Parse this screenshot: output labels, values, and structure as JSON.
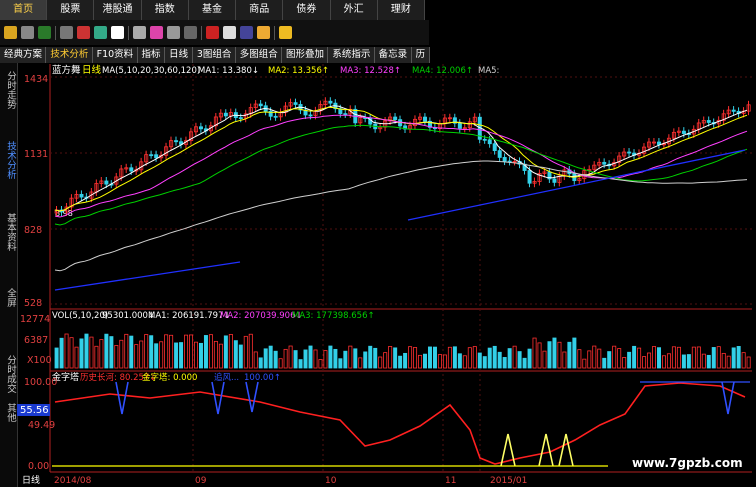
{
  "menu": [
    {
      "label": "首页",
      "active": true
    },
    {
      "label": "股票",
      "active": false
    },
    {
      "label": "港股通",
      "active": false
    },
    {
      "label": "指数",
      "active": false
    },
    {
      "label": "基金",
      "active": false
    },
    {
      "label": "商品",
      "active": false
    },
    {
      "label": "债券",
      "active": false
    },
    {
      "label": "外汇",
      "active": false
    },
    {
      "label": "理财",
      "active": false
    }
  ],
  "tabs": [
    {
      "label": "经典方案",
      "sel": false
    },
    {
      "label": "技术分析",
      "sel": true
    },
    {
      "label": "F10资料",
      "sel": false
    },
    {
      "label": "指标",
      "sel": false
    },
    {
      "label": "日线",
      "sel": false
    },
    {
      "label": "3图组合",
      "sel": false
    },
    {
      "label": "多图组合",
      "sel": false
    },
    {
      "label": "图形叠加",
      "sel": false
    },
    {
      "label": "系统指示",
      "sel": false
    },
    {
      "label": "备忘录",
      "sel": false
    },
    {
      "label": "历",
      "sel": false
    }
  ],
  "sidebar": [
    {
      "label": "分时走势",
      "sel": false
    },
    {
      "label": "技术分析",
      "sel": true
    },
    {
      "label": "基本资料",
      "sel": false
    },
    {
      "label": "全屏",
      "sel": false
    },
    {
      "label": "分时成交",
      "sel": false
    },
    {
      "label": "其他",
      "sel": false
    }
  ],
  "colors": {
    "up": "#ff3030",
    "down": "#33d0e8",
    "ma5": "#ffffff",
    "ma10": "#ffff00",
    "ma20": "#ff40ff",
    "ma30": "#00d000",
    "ma60": "#cfcfcf",
    "ma120": "#2030ff"
  },
  "main": {
    "indicator_text": "MA(5,10,20,30,60,120)",
    "legend": [
      {
        "text": "MA1: 13.380↓",
        "color": "#ffffff"
      },
      {
        "text": "MA2: 13.356↑",
        "color": "#ffff00"
      },
      {
        "text": "MA3: 12.528↑",
        "color": "#ff40ff"
      },
      {
        "text": "MA4: 12.006↑",
        "color": "#00d000"
      },
      {
        "text": "MA5:",
        "color": "#cfcfcf"
      }
    ],
    "stock_name": "蓝方舞",
    "period": "日线",
    "price_labels": [
      "1434",
      "1131",
      "828",
      "528"
    ],
    "low_label": "8.98"
  },
  "volume": {
    "label": "VOL(5,10,20)",
    "legend": [
      {
        "text": "95301.000↓",
        "color": "#ffffff"
      },
      {
        "text": "MA1: 206191.797↓",
        "color": "#ffffff"
      },
      {
        "text": "MA2: 207039.906↓",
        "color": "#ff40ff"
      },
      {
        "text": "MA3: 177398.656↑",
        "color": "#00d000"
      }
    ],
    "axis_labels": [
      "12774",
      "6387",
      "X100"
    ]
  },
  "golden": {
    "title": "金字塔",
    "legend": [
      {
        "text": "历史长河: 80.257↓",
        "color": "#ff3030"
      },
      {
        "text": "金字塔: 0.000",
        "color": "#ffff00"
      },
      {
        "text": "追风...",
        "color": "#3050ff"
      },
      {
        "text": "100.00↑",
        "color": "#3050ff"
      }
    ],
    "axis_labels": [
      "100.00",
      "49.49",
      "0.00"
    ],
    "current_value": "55.56"
  },
  "dates": [
    "2014/08",
    "09",
    "10",
    "11",
    "2015/01"
  ],
  "bottom_period": "日线",
  "watermark": "www.7gpzb.com"
}
